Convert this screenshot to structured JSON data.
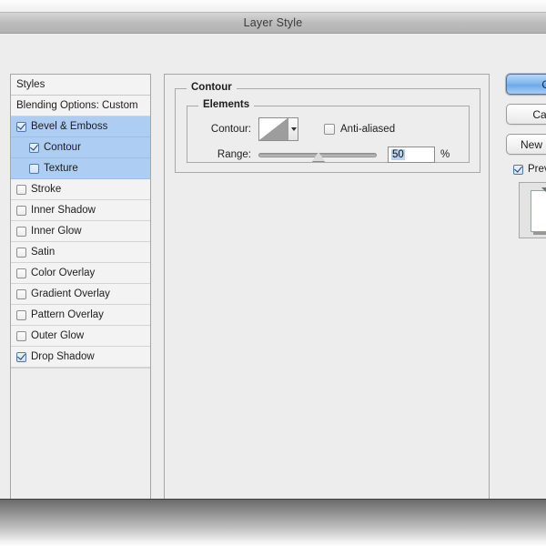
{
  "window": {
    "title": "Layer Style"
  },
  "styles_panel": {
    "header_label": "Styles",
    "blending_label": "Blending Options: Custom",
    "items": [
      {
        "label": "Bevel & Emboss",
        "checked": true,
        "selected": true,
        "nested": false
      },
      {
        "label": "Contour",
        "checked": true,
        "selected": true,
        "nested": true
      },
      {
        "label": "Texture",
        "checked": false,
        "selected": true,
        "nested": true
      },
      {
        "label": "Stroke",
        "checked": false,
        "selected": false,
        "nested": false
      },
      {
        "label": "Inner Shadow",
        "checked": false,
        "selected": false,
        "nested": false
      },
      {
        "label": "Inner Glow",
        "checked": false,
        "selected": false,
        "nested": false
      },
      {
        "label": "Satin",
        "checked": false,
        "selected": false,
        "nested": false
      },
      {
        "label": "Color Overlay",
        "checked": false,
        "selected": false,
        "nested": false
      },
      {
        "label": "Gradient Overlay",
        "checked": false,
        "selected": false,
        "nested": false
      },
      {
        "label": "Pattern Overlay",
        "checked": false,
        "selected": false,
        "nested": false
      },
      {
        "label": "Outer Glow",
        "checked": false,
        "selected": false,
        "nested": false
      },
      {
        "label": "Drop Shadow",
        "checked": true,
        "selected": false,
        "nested": false
      }
    ]
  },
  "contour_panel": {
    "group_title": "Contour",
    "elements_title": "Elements",
    "contour_label": "Contour:",
    "contour_swatch_icon": "contour-curve-icon",
    "contour_dropdown_icon": "chevron-down-icon",
    "anti_aliased_label": "Anti-aliased",
    "anti_aliased_checked": false,
    "range_label": "Range:",
    "range_value": "50",
    "range_unit": "%",
    "range_slider_percent": 50
  },
  "buttons": {
    "ok": "OK",
    "cancel": "Cancel",
    "new_style": "New Style...",
    "preview_label": "Preview",
    "preview_checked": true
  },
  "colors": {
    "selection_blue": "#aecdf2",
    "primary_button": "#83b7ef",
    "dialog_bg": "#ededed",
    "panel_border": "#a6a6a6"
  }
}
